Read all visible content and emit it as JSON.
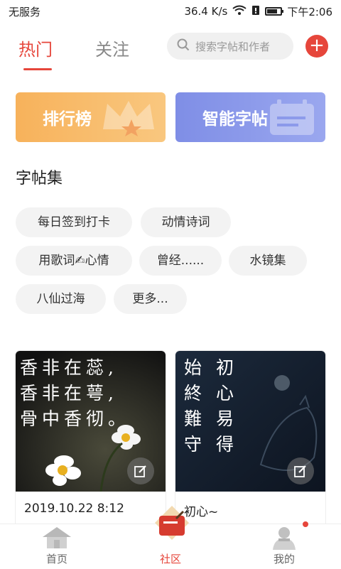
{
  "status_bar": {
    "carrier": "无服务",
    "speed": "36.4 K/s",
    "time": "下午2:06"
  },
  "header": {
    "tabs": [
      {
        "label": "热门",
        "active": true
      },
      {
        "label": "关注",
        "active": false
      }
    ],
    "search": {
      "placeholder": "搜索字帖和作者"
    },
    "add_icon": "plus-icon"
  },
  "banners": [
    {
      "label": "排行榜"
    },
    {
      "label": "智能字帖"
    }
  ],
  "collection": {
    "title": "字帖集",
    "chips": [
      "每日签到打卡",
      "动情诗词",
      "用歌词✍心情",
      "曾经......",
      "水镜集",
      "八仙过海",
      "更多..."
    ]
  },
  "cards": [
    {
      "poem_lines": [
        "香非在蕊,",
        "香非在萼,",
        "骨中香彻。"
      ],
      "caption": "2019.10.22 8:12"
    },
    {
      "poem_lines": [
        "始  初",
        "終  心",
        "難  易",
        "守  得"
      ],
      "caption": "初心~"
    }
  ],
  "bottom_nav": [
    {
      "label": "首页",
      "icon": "home-icon"
    },
    {
      "label": "社区",
      "icon": "community-icon",
      "active": true
    },
    {
      "label": "我的",
      "icon": "profile-icon"
    }
  ],
  "colors": {
    "accent": "#e6463b",
    "rank_banner": "#f7b25b",
    "smart_banner": "#7f8ee6"
  }
}
